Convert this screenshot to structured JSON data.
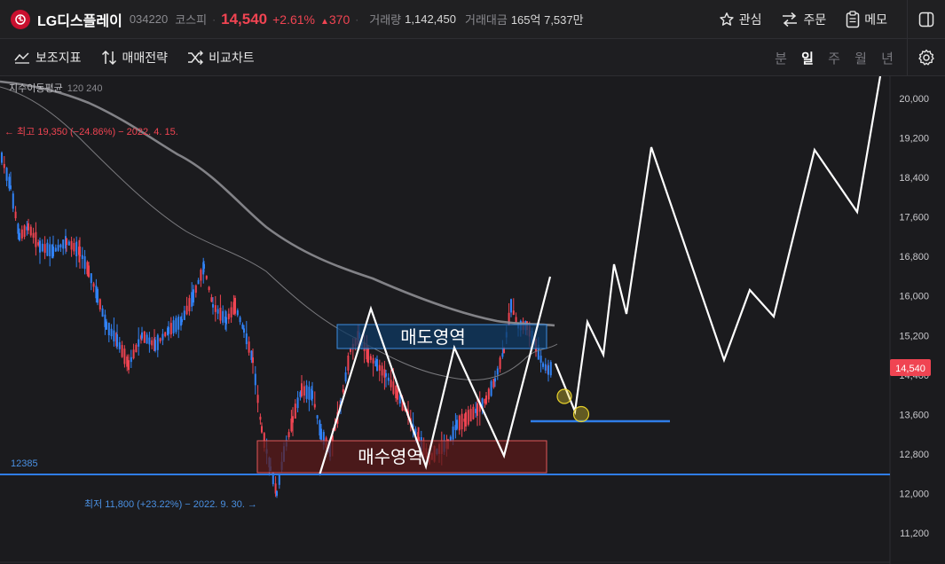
{
  "header": {
    "stock_name": "LG디스플레이",
    "code": "034220",
    "market": "코스피",
    "price": "14,540",
    "change_pct": "+2.61%",
    "change_abs": "370",
    "volume_label": "거래량",
    "volume_value": "1,142,450",
    "trade_amount_label": "거래대금",
    "trade_amount_value": "165억 7,537만",
    "actions": {
      "watch": "관심",
      "order": "주문",
      "memo": "메모"
    }
  },
  "toolbar": {
    "indicators": "보조지표",
    "strategy": "매매전략",
    "compare": "비교차트",
    "periods": [
      "분",
      "일",
      "주",
      "월",
      "년"
    ],
    "active_period": "일"
  },
  "chart": {
    "ma_legend": "지수이동평균",
    "ma_periods": "120 240",
    "high_annotation": "← 최고 19,350 (−24.86%) − 2022. 4. 15.",
    "low_annotation": "최저 11,800 (+23.22%) − 2022. 9. 30. →",
    "support_label": "12385",
    "sell_zone_label": "매도영역",
    "buy_zone_label": "매수영역",
    "current_price_tag": "14,540",
    "y_ticks": [
      "20,000",
      "19,200",
      "18,400",
      "17,600",
      "16,800",
      "16,000",
      "15,200",
      "14,400",
      "13,600",
      "12,800",
      "12,000",
      "11,200"
    ],
    "y_tick_values": [
      20000,
      19200,
      18400,
      17600,
      16800,
      16000,
      15200,
      14400,
      13600,
      12800,
      12000,
      11200
    ],
    "colors": {
      "up": "#f04452",
      "down": "#3182f6",
      "support_line": "#2f7de8",
      "current": "#f04452"
    }
  }
}
